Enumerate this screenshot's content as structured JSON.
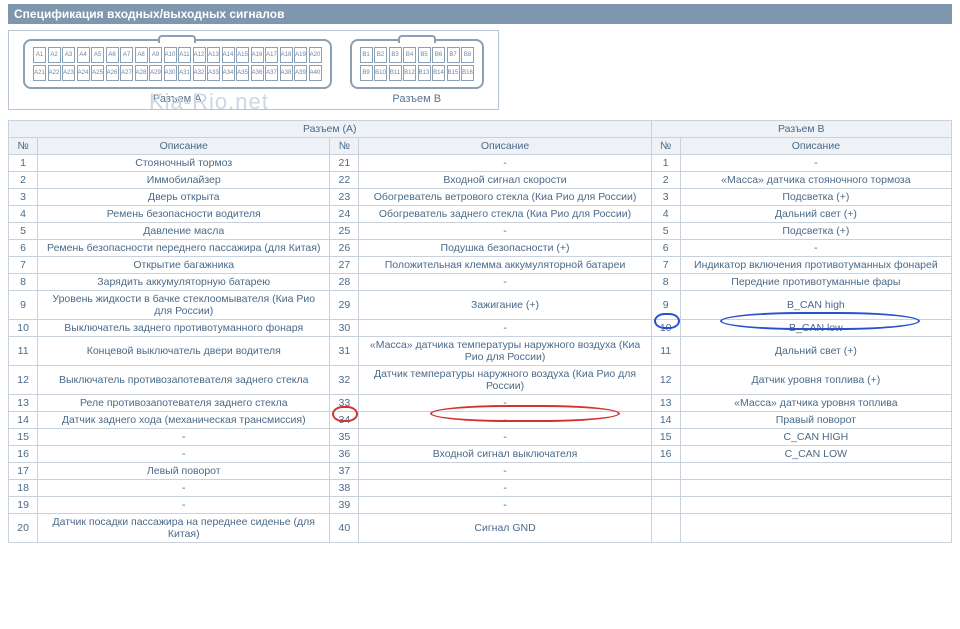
{
  "title": "Спецификация входных/выходных сигналов",
  "connectorA": {
    "label": "Разъем A",
    "rows": [
      [
        "A1",
        "A2",
        "A3",
        "A4",
        "A5",
        "A6",
        "A7",
        "A8",
        "A9",
        "A10",
        "A11",
        "A12",
        "A13",
        "A14",
        "A15",
        "A16",
        "A17",
        "A18",
        "A19",
        "A20"
      ],
      [
        "A21",
        "A22",
        "A23",
        "A24",
        "A25",
        "A26",
        "A27",
        "A28",
        "A29",
        "A30",
        "A31",
        "A32",
        "A33",
        "A34",
        "A35",
        "A36",
        "A37",
        "A38",
        "A39",
        "A40"
      ]
    ]
  },
  "connectorB": {
    "label": "Разъем B",
    "rows": [
      [
        "B1",
        "B2",
        "B3",
        "B4",
        "B5",
        "B6",
        "B7",
        "B8"
      ],
      [
        "B9",
        "B10",
        "B11",
        "B12",
        "B13",
        "B14",
        "B15",
        "B16"
      ]
    ]
  },
  "watermark": "Kia-Rio.net",
  "headers": {
    "sectionA": "Разъем (А)",
    "sectionB": "Разъем В",
    "num": "№",
    "desc": "Описание"
  },
  "tableA": [
    {
      "n1": "1",
      "d1": "Стояночный тормоз",
      "n2": "21",
      "d2": "-"
    },
    {
      "n1": "2",
      "d1": "Иммобилайзер",
      "n2": "22",
      "d2": "Входной сигнал скорости"
    },
    {
      "n1": "3",
      "d1": "Дверь открыта",
      "n2": "23",
      "d2": "Обогреватель ветрового стекла (Киа Рио для России)"
    },
    {
      "n1": "4",
      "d1": "Ремень безопасности водителя",
      "n2": "24",
      "d2": "Обогреватель заднего стекла (Киа Рио для России)"
    },
    {
      "n1": "5",
      "d1": "Давление масла",
      "n2": "25",
      "d2": "-"
    },
    {
      "n1": "6",
      "d1": "Ремень безопасности переднего пассажира (для Китая)",
      "n2": "26",
      "d2": "Подушка безопасности (+)"
    },
    {
      "n1": "7",
      "d1": "Открытие багажника",
      "n2": "27",
      "d2": "Положительная клемма аккумуляторной батареи"
    },
    {
      "n1": "8",
      "d1": "Зарядить аккумуляторную батарею",
      "n2": "28",
      "d2": "-"
    },
    {
      "n1": "9",
      "d1": "Уровень жидкости в бачке стеклоомывателя (Киа Рио для России)",
      "n2": "29",
      "d2": "Зажигание (+)"
    },
    {
      "n1": "10",
      "d1": "Выключатель заднего противотуманного фонаря",
      "n2": "30",
      "d2": "-"
    },
    {
      "n1": "11",
      "d1": "Концевой выключатель двери водителя",
      "n2": "31",
      "d2": "«Масса» датчика температуры наружного воздуха (Киа Рио для России)"
    },
    {
      "n1": "12",
      "d1": "Выключатель противозапотевателя заднего стекла",
      "n2": "32",
      "d2": "Датчик температуры наружного воздуха (Киа Рио для России)"
    },
    {
      "n1": "13",
      "d1": "Реле противозапотевателя заднего стекла",
      "n2": "33",
      "d2": "-"
    },
    {
      "n1": "14",
      "d1": "Датчик заднего хода (механическая трансмиссия)",
      "n2": "34",
      "d2": "-"
    },
    {
      "n1": "15",
      "d1": "-",
      "n2": "35",
      "d2": "-"
    },
    {
      "n1": "16",
      "d1": "-",
      "n2": "36",
      "d2": "Входной сигнал выключателя"
    },
    {
      "n1": "17",
      "d1": "Левый поворот",
      "n2": "37",
      "d2": "-"
    },
    {
      "n1": "18",
      "d1": "-",
      "n2": "38",
      "d2": "-"
    },
    {
      "n1": "19",
      "d1": "-",
      "n2": "39",
      "d2": "-"
    },
    {
      "n1": "20",
      "d1": "Датчик посадки пассажира на переднее сиденье (для Китая)",
      "n2": "40",
      "d2": "Сигнал GND"
    }
  ],
  "tableB": [
    {
      "n": "1",
      "d": "-"
    },
    {
      "n": "2",
      "d": "«Масса» датчика стояночного тормоза"
    },
    {
      "n": "3",
      "d": "Подсветка (+)"
    },
    {
      "n": "4",
      "d": "Дальний свет (+)"
    },
    {
      "n": "5",
      "d": "Подсветка (+)"
    },
    {
      "n": "6",
      "d": "-"
    },
    {
      "n": "7",
      "d": "Индикатор включения противотуманных фонарей"
    },
    {
      "n": "8",
      "d": "Передние противотуманные фары"
    },
    {
      "n": "9",
      "d": "B_CAN high"
    },
    {
      "n": "10",
      "d": "B_CAN low"
    },
    {
      "n": "11",
      "d": "Дальний свет (+)"
    },
    {
      "n": "12",
      "d": "Датчик уровня топлива (+)"
    },
    {
      "n": "13",
      "d": "«Масса» датчика уровня топлива"
    },
    {
      "n": "14",
      "d": "Правый поворот"
    },
    {
      "n": "15",
      "d": "C_CAN HIGH"
    },
    {
      "n": "16",
      "d": "C_CAN LOW"
    }
  ]
}
